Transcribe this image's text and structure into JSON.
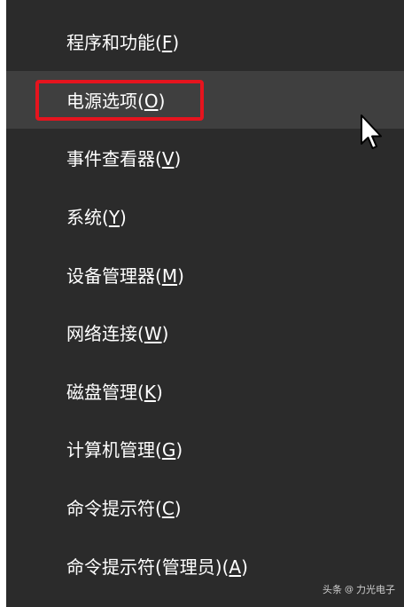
{
  "menu": {
    "items": [
      {
        "text": "程序和功能",
        "key": "F"
      },
      {
        "text": "电源选项",
        "key": "O"
      },
      {
        "text": "事件查看器",
        "key": "V"
      },
      {
        "text": "系统",
        "key": "Y"
      },
      {
        "text": "设备管理器",
        "key": "M"
      },
      {
        "text": "网络连接",
        "key": "W"
      },
      {
        "text": "磁盘管理",
        "key": "K"
      },
      {
        "text": "计算机管理",
        "key": "G"
      },
      {
        "text": "命令提示符",
        "key": "C"
      },
      {
        "text": "命令提示符(管理员)",
        "key": "A"
      }
    ]
  },
  "watermark": {
    "prefix": "头条",
    "account": "力光电子"
  },
  "colors": {
    "background": "#2b2b2b",
    "hover": "#3f3f3f",
    "highlight_border": "#e6141e",
    "text": "#ffffff"
  }
}
